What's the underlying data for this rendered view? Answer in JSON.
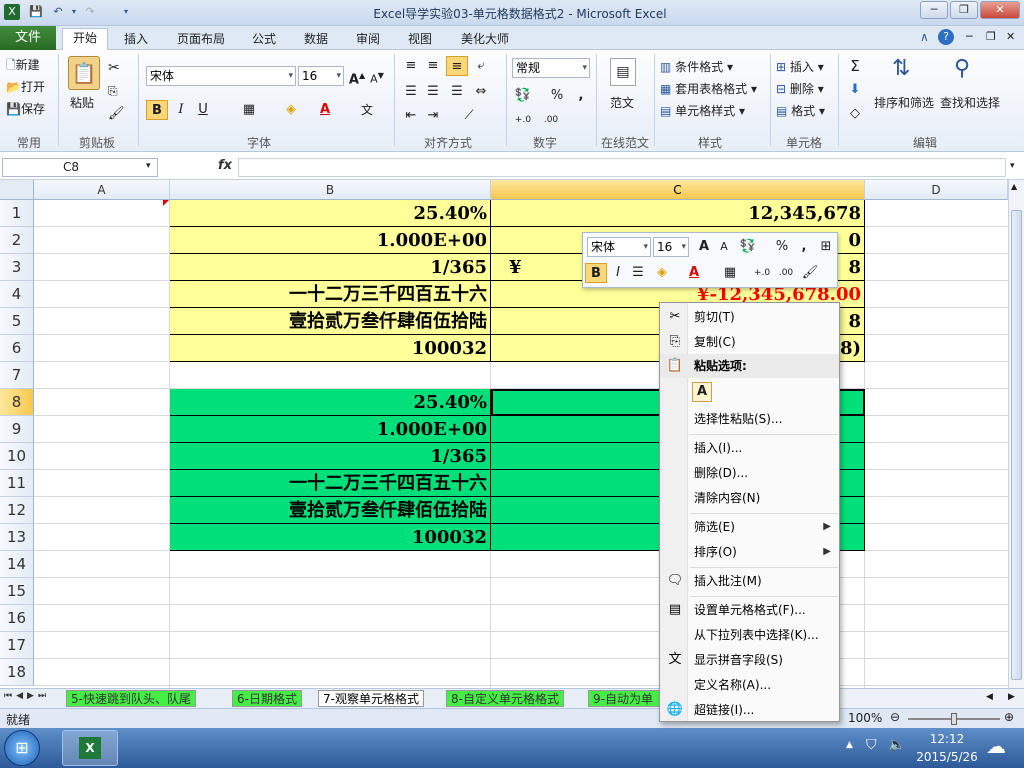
{
  "window": {
    "title": "Excel导学实验03-单元格数据格式2 - Microsoft Excel",
    "minimize": "─",
    "maximize": "❐",
    "close": "✕"
  },
  "tabs": {
    "file": "文件",
    "items": [
      "开始",
      "插入",
      "页面布局",
      "公式",
      "数据",
      "审阅",
      "视图",
      "美化大师"
    ]
  },
  "ribbon": {
    "new": "新建",
    "open": "打开",
    "save": "保存",
    "paste": "粘贴",
    "font_name": "宋体",
    "font_size": "16",
    "number_format": "常规",
    "fanwen": "范文",
    "conditional_format": "条件格式",
    "table_format": "套用表格格式",
    "cell_style": "单元格样式",
    "insert": "插入",
    "delete": "删除",
    "format": "格式",
    "sort_filter": "排序和筛选",
    "find_select": "查找和选择",
    "groups": {
      "common": "常用",
      "clipboard": "剪贴板",
      "font": "字体",
      "alignment": "对齐方式",
      "number": "数字",
      "online": "在线范文",
      "styles": "样式",
      "cells": "单元格",
      "editing": "编辑"
    }
  },
  "formula_bar": {
    "name_box": "C8",
    "fx": "fx",
    "value": ""
  },
  "columns": [
    "A",
    "B",
    "C",
    "D"
  ],
  "rows": [
    "1",
    "2",
    "3",
    "4",
    "5",
    "6",
    "7",
    "8",
    "9",
    "10",
    "11",
    "12",
    "13",
    "14",
    "15",
    "16",
    "17",
    "18"
  ],
  "cells": {
    "B1": "25.40%",
    "B2": "1.000E+00",
    "B3": "1/365",
    "B4": "一十二万三千四百五十六",
    "B5": "壹拾贰万叁仟肆佰伍拾陆",
    "B6": "100032",
    "C1": "12,345,678",
    "C2": "0",
    "C3_left": "¥",
    "C3_right": "8",
    "C4": "¥-12,345,678.00",
    "C5": "8",
    "C6": "8)",
    "B8": "25.40%",
    "B9": "1.000E+00",
    "B10": "1/365",
    "B11": "一十二万三千四百五十六",
    "B12": "壹拾贰万叁仟肆佰伍拾陆",
    "B13": "100032"
  },
  "colors": {
    "yellow_fill": "#ffff99",
    "green_fill": "#00e07a",
    "negative_red": "#ff0000"
  },
  "mini_toolbar": {
    "font_name": "宋体",
    "font_size": "16"
  },
  "context_menu": {
    "cut": "剪切(T)",
    "copy": "复制(C)",
    "paste_options": "粘贴选项:",
    "paste_A": "A",
    "paste_special": "选择性粘贴(S)...",
    "insert": "插入(I)...",
    "delete": "删除(D)...",
    "clear": "清除内容(N)",
    "filter": "筛选(E)",
    "sort": "排序(O)",
    "insert_comment": "插入批注(M)",
    "format_cells": "设置单元格格式(F)...",
    "pick_list": "从下拉列表中选择(K)...",
    "phonetic": "显示拼音字段(S)",
    "define_name": "定义名称(A)...",
    "hyperlink": "超链接(I)..."
  },
  "sheet_tabs": [
    "5-快速跳到队头、队尾",
    "6-日期格式",
    "7-观察单元格格式",
    "8-自定义单元格格式",
    "9-自动为单"
  ],
  "status": {
    "ready": "就绪",
    "zoom": "100%"
  },
  "taskbar": {
    "time": "12:12",
    "date": "2015/5/26"
  }
}
